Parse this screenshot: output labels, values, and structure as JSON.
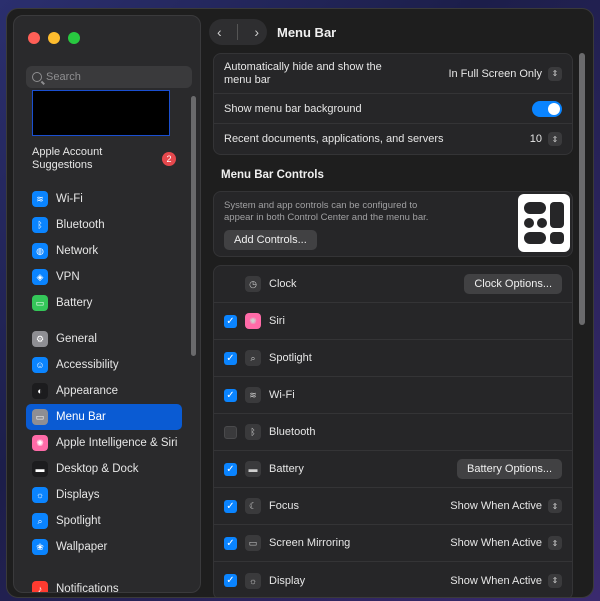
{
  "window": {
    "title": "Menu Bar"
  },
  "sidebar": {
    "search_placeholder": "Search",
    "suggestions_label": "Apple Account Suggestions",
    "suggestions_badge": "2",
    "items": [
      {
        "label": "Wi-Fi",
        "icon": "wifi-icon",
        "color": "#0a84ff",
        "glyph": "≋"
      },
      {
        "label": "Bluetooth",
        "icon": "bluetooth-icon",
        "color": "#0a84ff",
        "glyph": "ᛒ"
      },
      {
        "label": "Network",
        "icon": "network-icon",
        "color": "#0a84ff",
        "glyph": "◍"
      },
      {
        "label": "VPN",
        "icon": "vpn-icon",
        "color": "#0a84ff",
        "glyph": "◈"
      },
      {
        "label": "Battery",
        "icon": "battery-icon",
        "color": "#34c759",
        "glyph": "▭"
      },
      {
        "label": "General",
        "icon": "gear-icon",
        "color": "#8e8e93",
        "glyph": "⚙"
      },
      {
        "label": "Accessibility",
        "icon": "accessibility-icon",
        "color": "#0a84ff",
        "glyph": "☺"
      },
      {
        "label": "Appearance",
        "icon": "appearance-icon",
        "color": "#1c1c1e",
        "glyph": "◐"
      },
      {
        "label": "Menu Bar",
        "icon": "menu-bar-icon",
        "color": "#8e8e93",
        "glyph": "▭",
        "active": true
      },
      {
        "label": "Apple Intelligence & Siri",
        "icon": "siri-icon",
        "color": "#ff6ba8",
        "glyph": "✺"
      },
      {
        "label": "Desktop & Dock",
        "icon": "desktop-dock-icon",
        "color": "#1c1c1e",
        "glyph": "▬"
      },
      {
        "label": "Displays",
        "icon": "displays-icon",
        "color": "#0a84ff",
        "glyph": "☼"
      },
      {
        "label": "Spotlight",
        "icon": "spotlight-icon",
        "color": "#0a84ff",
        "glyph": "⌕"
      },
      {
        "label": "Wallpaper",
        "icon": "wallpaper-icon",
        "color": "#0a84ff",
        "glyph": "❀"
      },
      {
        "label": "Notifications",
        "icon": "notifications-icon",
        "color": "#ff3b30",
        "glyph": "♪"
      }
    ]
  },
  "settings": {
    "auto_hide_label": "Automatically hide and show the menu bar",
    "auto_hide_value": "In Full Screen Only",
    "show_background_label": "Show menu bar background",
    "show_background_on": true,
    "recent_label": "Recent documents, applications, and servers",
    "recent_value": "10"
  },
  "controls": {
    "section_title": "Menu Bar Controls",
    "description": "System and app controls can be configured to appear in both Control Center and the menu bar.",
    "add_button": "Add Controls...",
    "items": [
      {
        "label": "Clock",
        "icon": "clock-icon",
        "glyph": "◷",
        "checkbox": "none",
        "action_type": "button",
        "action": "Clock Options..."
      },
      {
        "label": "Siri",
        "icon": "siri-icon",
        "glyph": "✺",
        "checkbox": "on",
        "action_type": "none",
        "action": ""
      },
      {
        "label": "Spotlight",
        "icon": "spotlight-icon",
        "glyph": "⌕",
        "checkbox": "on",
        "action_type": "none",
        "action": ""
      },
      {
        "label": "Wi-Fi",
        "icon": "wifi-icon",
        "glyph": "≋",
        "checkbox": "on",
        "action_type": "none",
        "action": ""
      },
      {
        "label": "Bluetooth",
        "icon": "bluetooth-icon",
        "glyph": "ᛒ",
        "checkbox": "off",
        "action_type": "none",
        "action": ""
      },
      {
        "label": "Battery",
        "icon": "battery-icon",
        "glyph": "▬",
        "checkbox": "on",
        "action_type": "button",
        "action": "Battery Options..."
      },
      {
        "label": "Focus",
        "icon": "focus-icon",
        "glyph": "☾",
        "checkbox": "on",
        "action_type": "popup",
        "action": "Show When Active"
      },
      {
        "label": "Screen Mirroring",
        "icon": "screen-mirroring-icon",
        "glyph": "▭",
        "checkbox": "on",
        "action_type": "popup",
        "action": "Show When Active"
      },
      {
        "label": "Display",
        "icon": "display-icon",
        "glyph": "☼",
        "checkbox": "on",
        "action_type": "popup",
        "action": "Show When Active"
      }
    ]
  }
}
